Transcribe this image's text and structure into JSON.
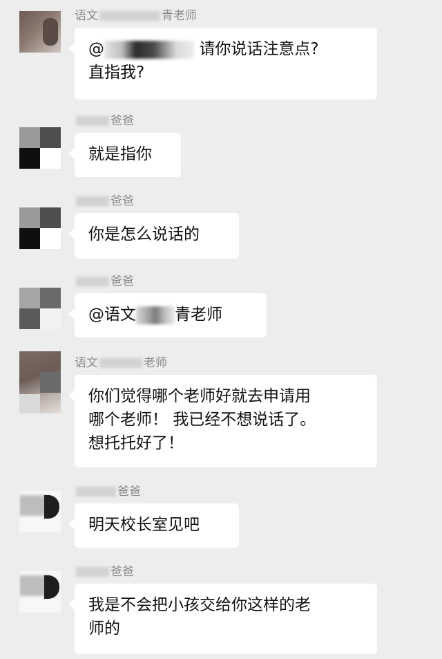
{
  "messages": [
    {
      "sender_prefix": "语文",
      "sender_suffix": "青老师",
      "lines": [
        "@",
        "请你说话注意点?",
        "直指我?"
      ]
    },
    {
      "sender_prefix": "",
      "sender_suffix": "爸爸",
      "lines": [
        "就是指你"
      ]
    },
    {
      "sender_prefix": "",
      "sender_suffix": "爸爸",
      "lines": [
        "你是怎么说话的"
      ]
    },
    {
      "sender_prefix": "",
      "sender_suffix": "爸爸",
      "lines": [
        "@语文",
        "青老师"
      ]
    },
    {
      "sender_prefix": "语文",
      "sender_suffix": "老师",
      "lines": [
        "你们觉得哪个老师好就去申请用",
        "哪个老师！ 我已经不想说话了。",
        "想托托好了！"
      ]
    },
    {
      "sender_prefix": "",
      "sender_suffix": "爸爸",
      "lines": [
        "明天校长室见吧"
      ]
    },
    {
      "sender_prefix": "",
      "sender_suffix": "爸爸",
      "lines": [
        "我是不会把小孩交给你这样的老",
        "师的"
      ]
    }
  ]
}
